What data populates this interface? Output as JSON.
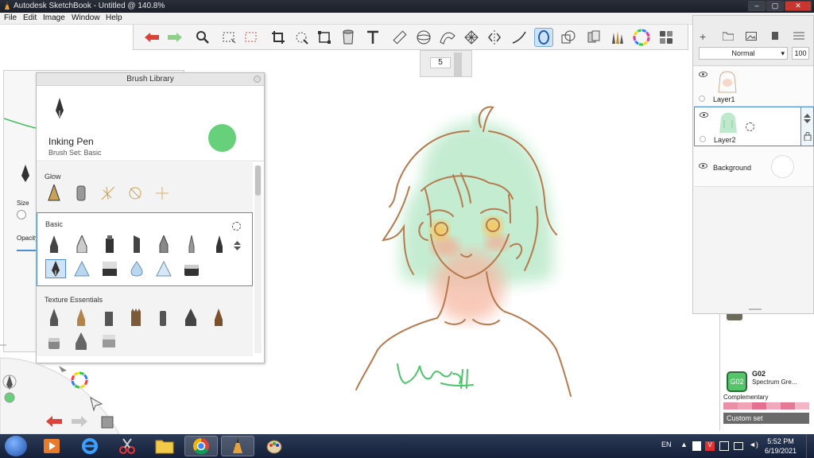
{
  "window": {
    "title": "Autodesk SketchBook - Untitled @ 140.8%",
    "controls": [
      "–",
      "▢",
      "✕"
    ]
  },
  "menu": [
    "File",
    "Edit",
    "Image",
    "Window",
    "Help"
  ],
  "toolbar": {
    "tools": [
      "undo-icon",
      "redo-icon",
      "zoom-icon",
      "select-rect-icon",
      "select-lasso-icon",
      "crop-icon",
      "transform-icon",
      "distort-icon",
      "fill-icon",
      "text-icon",
      "ruler-icon",
      "ellipse-guide-icon",
      "french-curve-icon",
      "perspective-icon",
      "symmetry-icon",
      "stroke-icon",
      "predictive-stroke-icon",
      "shape-icon",
      "copic-icon",
      "brush-library-icon",
      "color-wheel-icon",
      "brush-palette-icon"
    ],
    "active_tool": "predictive-stroke-icon"
  },
  "brush_size": {
    "value": "5"
  },
  "brush_library": {
    "header": "Brush Library",
    "current_brush": {
      "name": "Inking Pen",
      "set": "Brush Set: Basic",
      "color": "#66d17a"
    },
    "sections": {
      "glow": "Glow",
      "basic": "Basic",
      "texture": "Texture Essentials"
    }
  },
  "left_panel": {
    "size_label": "Size",
    "opacity_label": "Opacity"
  },
  "layers": {
    "blend_mode": "Normal",
    "opacity": "100",
    "items": [
      {
        "name": "Layer1"
      },
      {
        "name": "Layer2"
      },
      {
        "name": "Background"
      }
    ]
  },
  "color": {
    "copic_code": "G02",
    "copic_code_title": "G02",
    "copic_name": "Spectrum Gre...",
    "complementary": "Complementary",
    "custom_set": "Custom set",
    "swatch": "#56c46a"
  },
  "taskbar": {
    "language": "EN",
    "time": "5:52 PM",
    "date": "6/19/2021"
  }
}
